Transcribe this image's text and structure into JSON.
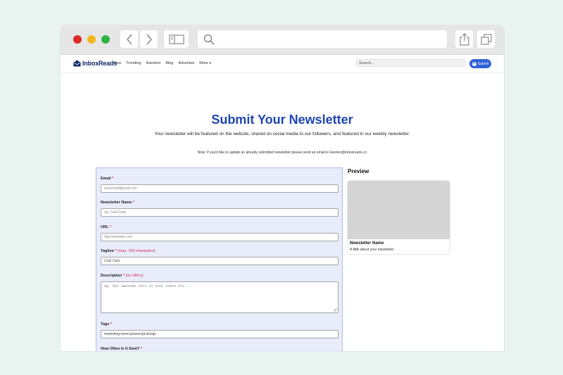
{
  "browser": {
    "icons": [
      "back-arrow-icon",
      "forward-arrow-icon",
      "sidebar-icon",
      "search-icon",
      "share-icon",
      "tabs-icon"
    ]
  },
  "nav": {
    "brand": "InboxReads",
    "links": [
      "New",
      "Trending",
      "Random",
      "Blog",
      "Advertise",
      "More"
    ],
    "search_placeholder": "Search...",
    "submit_label": "Submit"
  },
  "page": {
    "title": "Submit Your Newsletter",
    "subtitle": "Your newsletter will be featured on the website, shared on social media to our followers, and featured in our weekly newsletter.",
    "note": "Note: If you'd like to update an already submitted newsletter please send an email to keenen@inboxreads.co"
  },
  "form": {
    "required_mark": "*",
    "email": {
      "label": "Email",
      "placeholder": "youremail@mail.com"
    },
    "name": {
      "label": "Newsletter Name",
      "placeholder": "eg. Cars Daily"
    },
    "url": {
      "label": "URL",
      "placeholder": "http://website.com"
    },
    "tagline": {
      "label": "Tagline",
      "hint": "(max: 100 characters)",
      "value": "Cool Cars"
    },
    "description": {
      "label": "Description",
      "hint": "(no URLs)",
      "placeholder": "eg. Get awesome cars in your inbox etc..."
    },
    "tags": {
      "label": "Tags",
      "value": "marketing,travel,javascript,design"
    },
    "frequency": {
      "label": "How Often Is It Sent?"
    }
  },
  "preview": {
    "heading": "Preview",
    "name": "Newsletter Name",
    "description": "A little about your newsletter"
  },
  "colors": {
    "accent": "#2f63d8",
    "title": "#2046b3",
    "required": "#d6225a",
    "form_bg": "#e8ecfb"
  }
}
